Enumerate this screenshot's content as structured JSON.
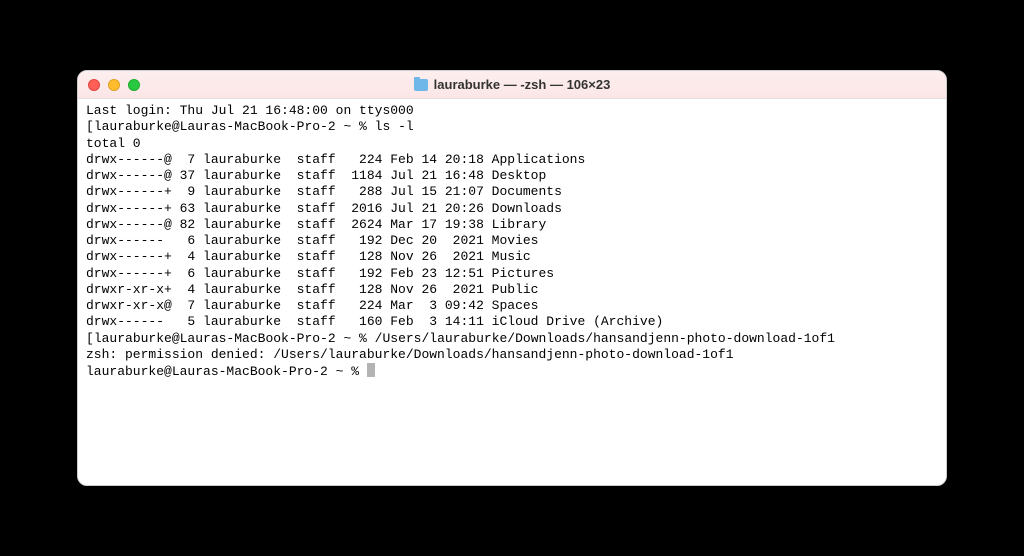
{
  "window": {
    "title": "lauraburke — -zsh — 106×23"
  },
  "lines": {
    "last_login": "Last login: Thu Jul 21 16:48:00 on ttys000",
    "prompt1_prefix": "[",
    "prompt1": "lauraburke@Lauras-MacBook-Pro-2 ~ % ",
    "cmd1": "ls -l",
    "total": "total 0",
    "rows": [
      "drwx------@  7 lauraburke  staff   224 Feb 14 20:18 Applications",
      "drwx------@ 37 lauraburke  staff  1184 Jul 21 16:48 Desktop",
      "drwx------+  9 lauraburke  staff   288 Jul 15 21:07 Documents",
      "drwx------+ 63 lauraburke  staff  2016 Jul 21 20:26 Downloads",
      "drwx------@ 82 lauraburke  staff  2624 Mar 17 19:38 Library",
      "drwx------   6 lauraburke  staff   192 Dec 20  2021 Movies",
      "drwx------+  4 lauraburke  staff   128 Nov 26  2021 Music",
      "drwx------+  6 lauraburke  staff   192 Feb 23 12:51 Pictures",
      "drwxr-xr-x+  4 lauraburke  staff   128 Nov 26  2021 Public",
      "drwxr-xr-x@  7 lauraburke  staff   224 Mar  3 09:42 Spaces",
      "drwx------   5 lauraburke  staff   160 Feb  3 14:11 iCloud Drive (Archive)"
    ],
    "prompt2_prefix": "[",
    "prompt2": "lauraburke@Lauras-MacBook-Pro-2 ~ % ",
    "cmd2": "/Users/lauraburke/Downloads/hansandjenn-photo-download-1of1",
    "error": "zsh: permission denied: /Users/lauraburke/Downloads/hansandjenn-photo-download-1of1",
    "prompt3": "lauraburke@Lauras-MacBook-Pro-2 ~ % "
  }
}
